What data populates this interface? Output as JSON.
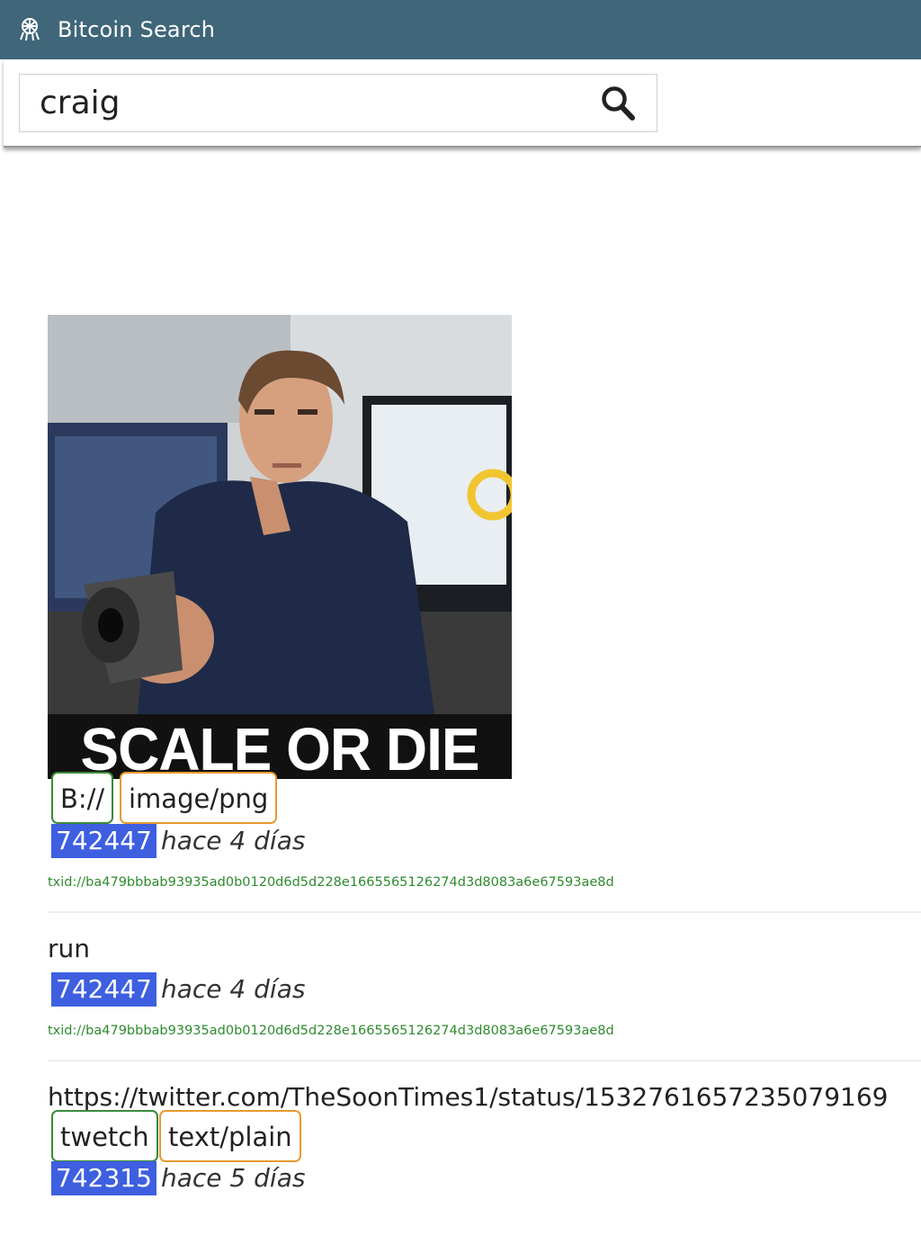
{
  "app": {
    "title": "Bitcoin Search",
    "accent": "#3f6679"
  },
  "search": {
    "value": "craig",
    "placeholder": ""
  },
  "results": [
    {
      "image_caption": "SCALE OR DIE",
      "tags": [
        {
          "label": "B://",
          "color": "green"
        },
        {
          "label": "image/png",
          "color": "orange"
        }
      ],
      "block": "742447",
      "when": "hace 4 días",
      "txid": "txid://ba479bbbab93935ad0b0120d6d5d228e1665565126274d3d8083a6e67593ae8d"
    },
    {
      "text": "run",
      "block": "742447",
      "when": "hace 4 días",
      "txid": "txid://ba479bbbab93935ad0b0120d6d5d228e1665565126274d3d8083a6e67593ae8d"
    },
    {
      "text": "https://twitter.com/TheSoonTimes1/status/1532761657235079169",
      "tags": [
        {
          "label": "twetch",
          "color": "green"
        },
        {
          "label": "text/plain",
          "color": "orange"
        }
      ],
      "block": "742315",
      "when": "hace 5 días"
    }
  ],
  "colors": {
    "block_badge": "#3d5fe0",
    "txid_text": "#2e8b2e",
    "tag_green": "#3a8a3a",
    "tag_orange": "#e69a2e"
  }
}
